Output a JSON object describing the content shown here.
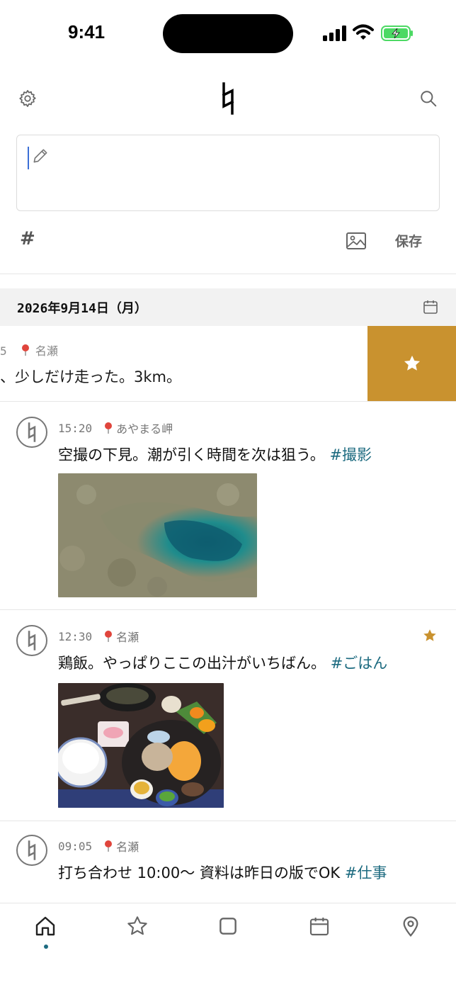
{
  "status": {
    "time": "9:41"
  },
  "composer": {
    "tag_label": "#",
    "save_label": "保存"
  },
  "date_header": {
    "date": "2026年9月14日（月）"
  },
  "swiped_entry": {
    "time_fragment": "5",
    "location": "名瀬",
    "text": "、少しだけ走った。3km。"
  },
  "entries": [
    {
      "time": "15:20",
      "location": "あやまる岬",
      "text": "空撮の下見。潮が引く時間を次は狙う。",
      "hashtag": "#撮影",
      "photo": "aerial reef lagoon",
      "starred": false
    },
    {
      "time": "12:30",
      "location": "名瀬",
      "text": "鶏飯。やっぱりここの出汁がいちばん。",
      "hashtag": "#ごはん",
      "photo": "keihan meal set",
      "starred": true
    },
    {
      "time": "09:05",
      "location": "名瀬",
      "text": "打ち合わせ 10:00〜 資料は昨日の版でOK",
      "hashtag": "#仕事",
      "photo": "",
      "starred": false
    }
  ],
  "tabs": [
    "home-icon",
    "star-icon",
    "square-icon",
    "calendar-icon",
    "location-pin-icon"
  ],
  "colors": {
    "accent": "#1d6b80",
    "favorite": "#c9922f",
    "caret": "#3b6fd6",
    "date_bar": "#f2f2f2"
  }
}
